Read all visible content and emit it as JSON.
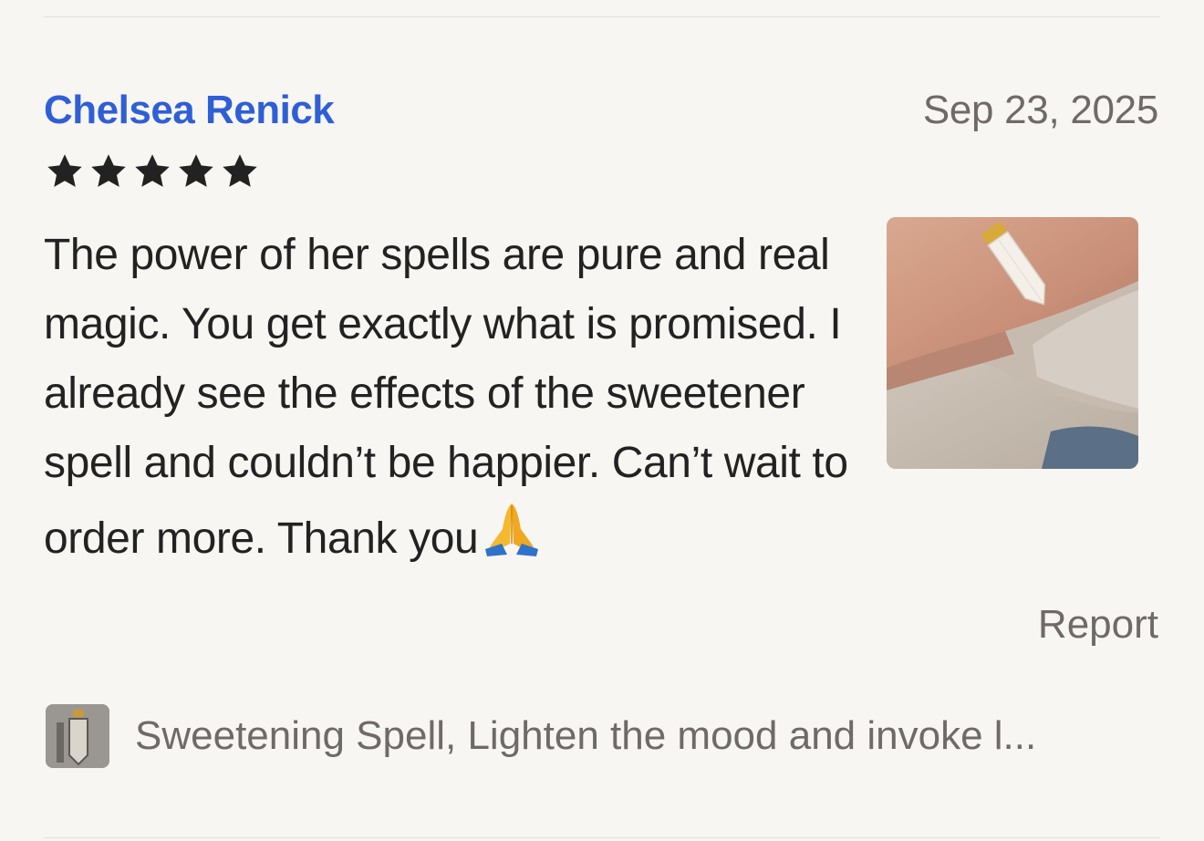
{
  "review": {
    "reviewer_name": "Chelsea Renick",
    "date": "Sep 23, 2025",
    "rating": 5,
    "rating_max": 5,
    "text": "The power of her spells are pure and real magic. You get exactly what is promised. I already see the effects of the sweetener spell and couldn’t be happier. Can’t wait to order more. Thank you",
    "text_emoji": "folded-hands-emoji",
    "photo_icon": "review-photo-crystal-pendant",
    "report_label": "Report"
  },
  "listing": {
    "thumb_icon": "listing-thumbnail-pendant",
    "title": "Sweetening Spell, Lighten the mood and invoke l..."
  },
  "colors": {
    "background": "#f8f6f3",
    "reviewer_link": "#2f5fd6",
    "muted_text": "#6f6a67",
    "body_text": "#222222",
    "star": "#222222",
    "divider": "#e2e0dc"
  }
}
